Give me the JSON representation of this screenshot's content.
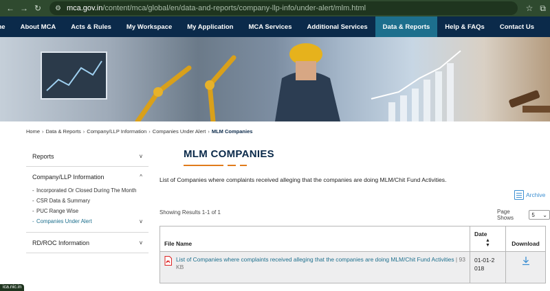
{
  "browser": {
    "url_host": "mca.gov.in",
    "url_path": "/content/mca/global/en/data-and-reports/company-llp-info/under-alert/mlm.html"
  },
  "nav": {
    "items": [
      "Home",
      "About MCA",
      "Acts & Rules",
      "My Workspace",
      "My Application",
      "MCA Services",
      "Additional Services",
      "Data & Reports",
      "Help & FAQs",
      "Contact Us"
    ],
    "active_index": 7
  },
  "breadcrumb": {
    "items": [
      "Home",
      "Data & Reports",
      "Company/LLP Information",
      "Companies Under Alert"
    ],
    "current": "MLM Companies"
  },
  "sidebar": {
    "sections": [
      {
        "label": "Reports",
        "state": "collapsed"
      },
      {
        "label": "Company/LLP Information",
        "state": "expanded",
        "sub_items": [
          "Incorporated Or Closed During The Month",
          "CSR Data & Summary",
          "PUC Range Wise",
          "Companies Under Alert"
        ]
      },
      {
        "label": "RD/ROC Information",
        "state": "collapsed"
      }
    ]
  },
  "main": {
    "title": "MLM COMPANIES",
    "description": "List of Companies where complaints received alleging that the companies are doing MLM/Chit Fund Activities.",
    "archive_label": "Archive",
    "results_info": "Showing Results 1-1 of 1",
    "page_size_label": "Page Shows",
    "page_size_value": "5"
  },
  "table": {
    "headers": {
      "file_name": "File Name",
      "date": "Date",
      "download": "Download"
    },
    "rows": [
      {
        "file_name": "List of Companies where complaints received alleging that the companies are doing MLM/Chit Fund Activities",
        "file_size": "| 93 KB",
        "date": "01-01-2018"
      }
    ]
  },
  "status_bar": "ica.nic.in",
  "colors": {
    "nav_bg": "#0b2a4a",
    "nav_active": "#1d6f8d",
    "accent_orange": "#e07b1a",
    "link_blue": "#1d6f8d"
  }
}
